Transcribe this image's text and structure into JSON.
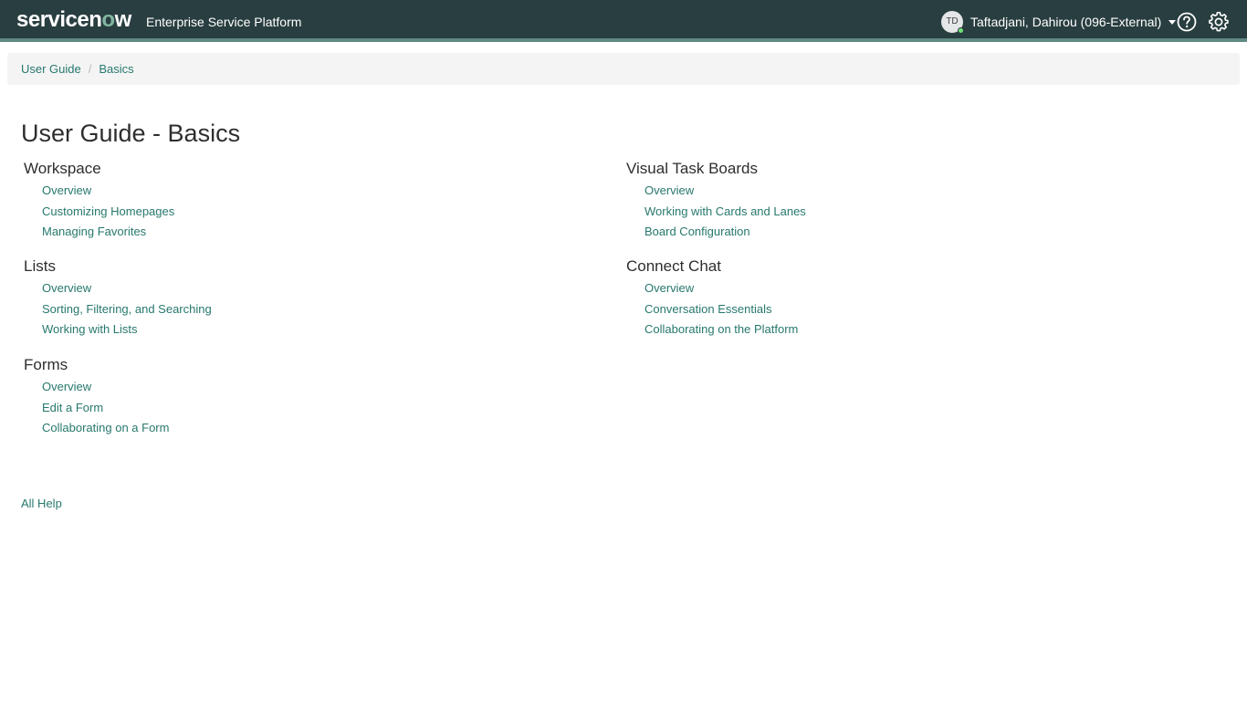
{
  "header": {
    "logo_text": "servicenow",
    "platform_name": "Enterprise Service Platform",
    "user_initials": "TD",
    "user_name": "Taftadjani, Dahirou (096-External)",
    "help_icon": "help-icon",
    "settings_icon": "gear-icon",
    "brand_color": "#293e40",
    "accent_color": "#81b5a1"
  },
  "breadcrumb": {
    "items": [
      "User Guide",
      "Basics"
    ],
    "separator": "/"
  },
  "page": {
    "title": "User Guide - Basics",
    "link_color": "#27786d"
  },
  "sections": [
    {
      "title": "Workspace",
      "links": [
        "Overview",
        "Customizing Homepages",
        "Managing Favorites"
      ]
    },
    {
      "title": "Lists",
      "links": [
        "Overview",
        "Sorting, Filtering, and Searching",
        "Working with Lists"
      ]
    },
    {
      "title": "Forms",
      "links": [
        "Overview",
        "Edit a Form",
        "Collaborating on a Form"
      ]
    },
    {
      "title": "Visual Task Boards",
      "links": [
        "Overview",
        "Working with Cards and Lanes",
        "Board Configuration"
      ]
    },
    {
      "title": "Connect Chat",
      "links": [
        "Overview",
        "Conversation Essentials",
        "Collaborating on the Platform"
      ]
    }
  ],
  "footer": {
    "all_help_label": "All Help"
  }
}
